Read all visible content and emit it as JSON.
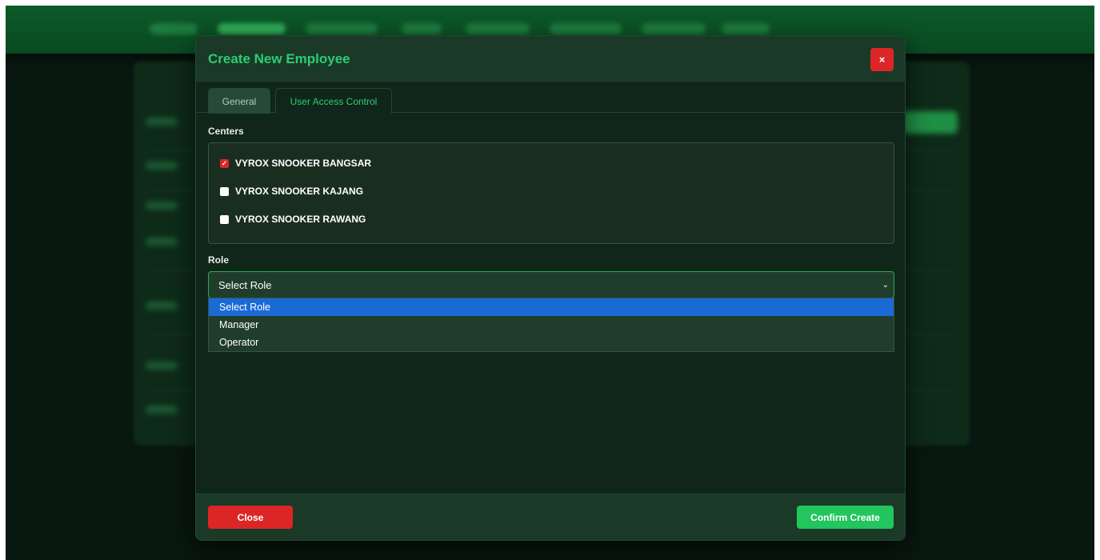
{
  "modal": {
    "title": "Create New Employee",
    "close_icon": "×",
    "tabs": [
      {
        "label": "General",
        "active": false
      },
      {
        "label": "User Access Control",
        "active": true
      }
    ],
    "centers_label": "Centers",
    "centers": [
      {
        "name": "VYROX SNOOKER BANGSAR",
        "checked": true
      },
      {
        "name": "VYROX SNOOKER KAJANG",
        "checked": false
      },
      {
        "name": "VYROX SNOOKER RAWANG",
        "checked": false
      }
    ],
    "role_label": "Role",
    "role_select": {
      "value": "Select Role",
      "options": [
        "Select Role",
        "Manager",
        "Operator"
      ],
      "highlighted_index": 0
    },
    "footer": {
      "close_label": "Close",
      "confirm_label": "Confirm Create"
    }
  },
  "colors": {
    "accent_green": "#2ecc71",
    "danger_red": "#dc2626",
    "confirm_green": "#22c55e",
    "highlight_blue": "#1a6ad6"
  }
}
